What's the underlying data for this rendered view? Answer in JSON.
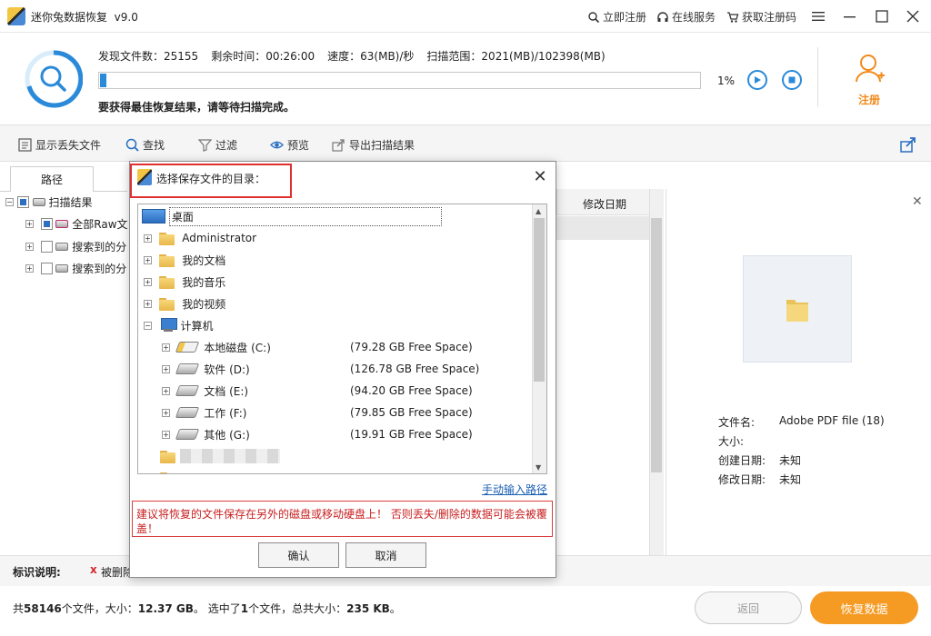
{
  "titlebar": {
    "title": "迷你兔数据恢复",
    "version": "v9.0",
    "register_link": "立即注册",
    "online_service": "在线服务",
    "get_code": "获取注册码",
    "icons": [
      "lock-icon",
      "headset-icon",
      "cart-icon",
      "menu-icon",
      "minimize-icon",
      "maximize-icon",
      "close-icon"
    ]
  },
  "scan": {
    "files_found_label": "发现文件数：",
    "files_found": "25155",
    "time_left_label": "剩余时间：",
    "time_left": "00:26:00",
    "speed_label": "速度：",
    "speed": "63(MB)/秒",
    "range_label": "扫描范围：",
    "range": "2021(MB)/102398(MB)",
    "progress_percent": "1%",
    "progress_value": 1,
    "tip": "要获得最佳恢复结果，请等待扫描完成。",
    "register_label": "注册"
  },
  "toolbar": {
    "show_lost": "显示丢失文件",
    "search": "查找",
    "filter": "过滤",
    "preview": "预览",
    "export": "导出扫描结果"
  },
  "left_panel": {
    "tab": "路径",
    "tree": [
      {
        "label": "扫描结果"
      },
      {
        "label": "全部Raw文"
      },
      {
        "label": "搜索到的分"
      },
      {
        "label": "搜索到的分"
      }
    ]
  },
  "file_list": {
    "col_modified": "修改日期"
  },
  "preview": {
    "filename_label": "文件名:",
    "filename": "Adobe PDF file (18)",
    "size_label": "大小:",
    "size": "",
    "created_label": "创建日期:",
    "created": "未知",
    "modified_label": "修改日期:",
    "modified": "未知"
  },
  "legend": {
    "label": "标识说明:",
    "deleted": "被删除"
  },
  "footer": {
    "total_prefix": "共",
    "total_files": "58146",
    "total_mid": "个文件，大小：",
    "total_size": "12.37 GB",
    "selected_prefix": "。 选中了",
    "selected_count": "1",
    "selected_mid": "个文件，总共大小：",
    "selected_size": "235 KB",
    "selected_suffix": "。",
    "back": "返回",
    "recover": "恢复数据"
  },
  "dialog": {
    "title": "选择保存文件的目录：",
    "tree": {
      "desktop": "桌面",
      "admin": "Administrator",
      "docs": "我的文档",
      "music": "我的音乐",
      "video": "我的视频",
      "computer": "计算机",
      "drives": [
        {
          "name": "本地磁盘 (C:)",
          "free": "(79.28 GB Free Space)"
        },
        {
          "name": "软件 (D:)",
          "free": "(126.78 GB Free Space)"
        },
        {
          "name": "文档 (E:)",
          "free": "(94.20 GB Free Space)"
        },
        {
          "name": "工作 (F:)",
          "free": "(79.85 GB Free Space)"
        },
        {
          "name": "其他 (G:)",
          "free": "(19.91 GB Free Space)"
        }
      ]
    },
    "manual_path": "手动输入路径",
    "warning": "建议将恢复的文件保存在另外的磁盘或移动硬盘上！ 否则丢失/删除的数据可能会被覆盖！",
    "ok": "确认",
    "cancel": "取消"
  },
  "colors": {
    "accent": "#2a8ad9",
    "orange": "#f59a23",
    "warning": "#c81e1e"
  }
}
